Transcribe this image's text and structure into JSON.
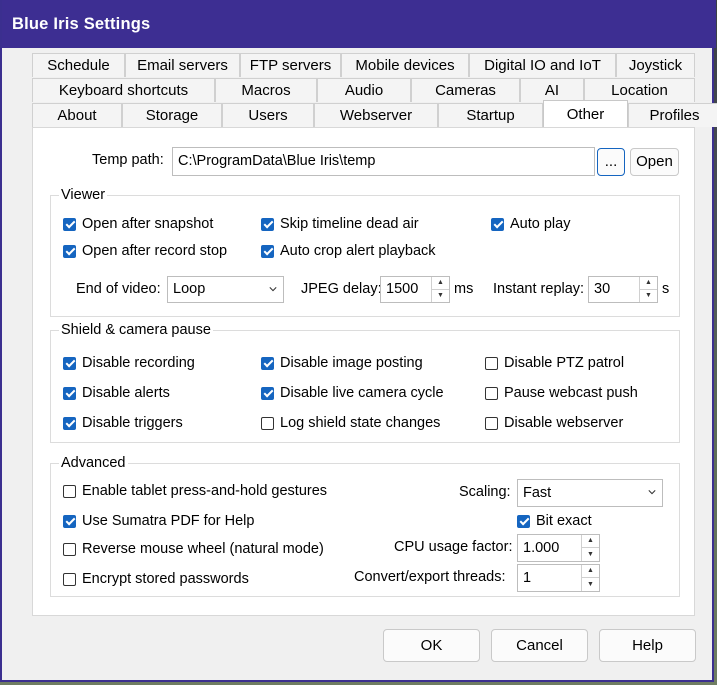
{
  "window": {
    "title": "Blue Iris Settings"
  },
  "tabs": {
    "row1": [
      "Schedule",
      "Email servers",
      "FTP servers",
      "Mobile devices",
      "Digital IO and IoT",
      "Joystick"
    ],
    "row2": [
      "Keyboard shortcuts",
      "Macros",
      "Audio",
      "Cameras",
      "AI",
      "Location"
    ],
    "row3": [
      "About",
      "Storage",
      "Users",
      "Webserver",
      "Startup",
      "Other",
      "Profiles"
    ],
    "active": "Other"
  },
  "temp_path": {
    "label": "Temp path:",
    "value": "C:\\ProgramData\\Blue Iris\\temp",
    "browse_label": "...",
    "open_label": "Open"
  },
  "viewer": {
    "title": "Viewer",
    "open_after_snapshot": {
      "label": "Open after snapshot",
      "checked": true
    },
    "skip_timeline_dead_air": {
      "label": "Skip timeline dead air",
      "checked": true
    },
    "auto_play": {
      "label": "Auto play",
      "checked": true
    },
    "open_after_record_stop": {
      "label": "Open after record stop",
      "checked": true
    },
    "auto_crop_alert_playback": {
      "label": "Auto crop alert playback",
      "checked": true
    },
    "end_of_video": {
      "label": "End of video:",
      "value": "Loop"
    },
    "jpeg_delay": {
      "label": "JPEG delay:",
      "value": "1500",
      "unit": "ms"
    },
    "instant_replay": {
      "label": "Instant replay:",
      "value": "30",
      "unit": "s"
    }
  },
  "shield": {
    "title": "Shield & camera pause",
    "disable_recording": {
      "label": "Disable recording",
      "checked": true
    },
    "disable_image_posting": {
      "label": "Disable image posting",
      "checked": true
    },
    "disable_ptz_patrol": {
      "label": "Disable PTZ patrol",
      "checked": false
    },
    "disable_alerts": {
      "label": "Disable alerts",
      "checked": true
    },
    "disable_live_camera_cycle": {
      "label": "Disable live camera cycle",
      "checked": true
    },
    "pause_webcast_push": {
      "label": "Pause webcast push",
      "checked": false
    },
    "disable_triggers": {
      "label": "Disable triggers",
      "checked": true
    },
    "log_shield_state_changes": {
      "label": "Log shield state changes",
      "checked": false
    },
    "disable_webserver": {
      "label": "Disable webserver",
      "checked": false
    }
  },
  "advanced": {
    "title": "Advanced",
    "tablet_press_hold": {
      "label": "Enable tablet press-and-hold gestures",
      "checked": false
    },
    "sumatra_pdf": {
      "label": "Use Sumatra PDF for Help",
      "checked": true
    },
    "reverse_mouse_wheel": {
      "label": "Reverse mouse wheel (natural mode)",
      "checked": false
    },
    "encrypt_passwords": {
      "label": "Encrypt stored passwords",
      "checked": false
    },
    "scaling": {
      "label": "Scaling:",
      "value": "Fast"
    },
    "bit_exact": {
      "label": "Bit exact",
      "checked": true
    },
    "cpu_usage_factor": {
      "label": "CPU usage factor:",
      "value": "1.000"
    },
    "convert_threads": {
      "label": "Convert/export threads:",
      "value": "1"
    }
  },
  "buttons": {
    "ok": "OK",
    "cancel": "Cancel",
    "help": "Help"
  }
}
